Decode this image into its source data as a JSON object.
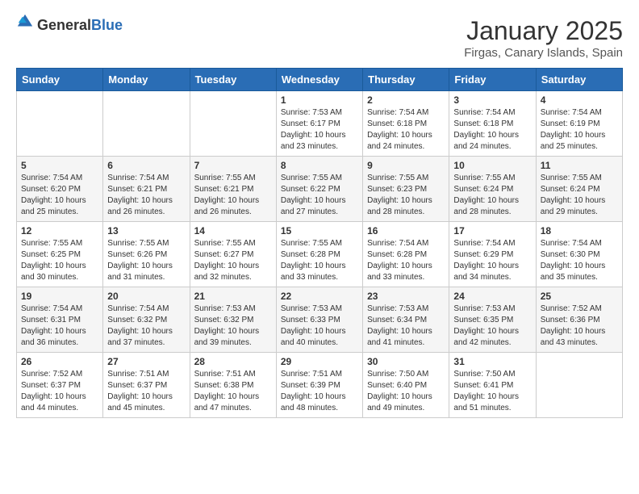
{
  "logo": {
    "general": "General",
    "blue": "Blue"
  },
  "title": "January 2025",
  "subtitle": "Firgas, Canary Islands, Spain",
  "weekdays": [
    "Sunday",
    "Monday",
    "Tuesday",
    "Wednesday",
    "Thursday",
    "Friday",
    "Saturday"
  ],
  "weeks": [
    [
      {
        "day": "",
        "info": ""
      },
      {
        "day": "",
        "info": ""
      },
      {
        "day": "",
        "info": ""
      },
      {
        "day": "1",
        "sunrise": "Sunrise: 7:53 AM",
        "sunset": "Sunset: 6:17 PM",
        "daylight": "Daylight: 10 hours and 23 minutes."
      },
      {
        "day": "2",
        "sunrise": "Sunrise: 7:54 AM",
        "sunset": "Sunset: 6:18 PM",
        "daylight": "Daylight: 10 hours and 24 minutes."
      },
      {
        "day": "3",
        "sunrise": "Sunrise: 7:54 AM",
        "sunset": "Sunset: 6:18 PM",
        "daylight": "Daylight: 10 hours and 24 minutes."
      },
      {
        "day": "4",
        "sunrise": "Sunrise: 7:54 AM",
        "sunset": "Sunset: 6:19 PM",
        "daylight": "Daylight: 10 hours and 25 minutes."
      }
    ],
    [
      {
        "day": "5",
        "sunrise": "Sunrise: 7:54 AM",
        "sunset": "Sunset: 6:20 PM",
        "daylight": "Daylight: 10 hours and 25 minutes."
      },
      {
        "day": "6",
        "sunrise": "Sunrise: 7:54 AM",
        "sunset": "Sunset: 6:21 PM",
        "daylight": "Daylight: 10 hours and 26 minutes."
      },
      {
        "day": "7",
        "sunrise": "Sunrise: 7:55 AM",
        "sunset": "Sunset: 6:21 PM",
        "daylight": "Daylight: 10 hours and 26 minutes."
      },
      {
        "day": "8",
        "sunrise": "Sunrise: 7:55 AM",
        "sunset": "Sunset: 6:22 PM",
        "daylight": "Daylight: 10 hours and 27 minutes."
      },
      {
        "day": "9",
        "sunrise": "Sunrise: 7:55 AM",
        "sunset": "Sunset: 6:23 PM",
        "daylight": "Daylight: 10 hours and 28 minutes."
      },
      {
        "day": "10",
        "sunrise": "Sunrise: 7:55 AM",
        "sunset": "Sunset: 6:24 PM",
        "daylight": "Daylight: 10 hours and 28 minutes."
      },
      {
        "day": "11",
        "sunrise": "Sunrise: 7:55 AM",
        "sunset": "Sunset: 6:24 PM",
        "daylight": "Daylight: 10 hours and 29 minutes."
      }
    ],
    [
      {
        "day": "12",
        "sunrise": "Sunrise: 7:55 AM",
        "sunset": "Sunset: 6:25 PM",
        "daylight": "Daylight: 10 hours and 30 minutes."
      },
      {
        "day": "13",
        "sunrise": "Sunrise: 7:55 AM",
        "sunset": "Sunset: 6:26 PM",
        "daylight": "Daylight: 10 hours and 31 minutes."
      },
      {
        "day": "14",
        "sunrise": "Sunrise: 7:55 AM",
        "sunset": "Sunset: 6:27 PM",
        "daylight": "Daylight: 10 hours and 32 minutes."
      },
      {
        "day": "15",
        "sunrise": "Sunrise: 7:55 AM",
        "sunset": "Sunset: 6:28 PM",
        "daylight": "Daylight: 10 hours and 33 minutes."
      },
      {
        "day": "16",
        "sunrise": "Sunrise: 7:54 AM",
        "sunset": "Sunset: 6:28 PM",
        "daylight": "Daylight: 10 hours and 33 minutes."
      },
      {
        "day": "17",
        "sunrise": "Sunrise: 7:54 AM",
        "sunset": "Sunset: 6:29 PM",
        "daylight": "Daylight: 10 hours and 34 minutes."
      },
      {
        "day": "18",
        "sunrise": "Sunrise: 7:54 AM",
        "sunset": "Sunset: 6:30 PM",
        "daylight": "Daylight: 10 hours and 35 minutes."
      }
    ],
    [
      {
        "day": "19",
        "sunrise": "Sunrise: 7:54 AM",
        "sunset": "Sunset: 6:31 PM",
        "daylight": "Daylight: 10 hours and 36 minutes."
      },
      {
        "day": "20",
        "sunrise": "Sunrise: 7:54 AM",
        "sunset": "Sunset: 6:32 PM",
        "daylight": "Daylight: 10 hours and 37 minutes."
      },
      {
        "day": "21",
        "sunrise": "Sunrise: 7:53 AM",
        "sunset": "Sunset: 6:32 PM",
        "daylight": "Daylight: 10 hours and 39 minutes."
      },
      {
        "day": "22",
        "sunrise": "Sunrise: 7:53 AM",
        "sunset": "Sunset: 6:33 PM",
        "daylight": "Daylight: 10 hours and 40 minutes."
      },
      {
        "day": "23",
        "sunrise": "Sunrise: 7:53 AM",
        "sunset": "Sunset: 6:34 PM",
        "daylight": "Daylight: 10 hours and 41 minutes."
      },
      {
        "day": "24",
        "sunrise": "Sunrise: 7:53 AM",
        "sunset": "Sunset: 6:35 PM",
        "daylight": "Daylight: 10 hours and 42 minutes."
      },
      {
        "day": "25",
        "sunrise": "Sunrise: 7:52 AM",
        "sunset": "Sunset: 6:36 PM",
        "daylight": "Daylight: 10 hours and 43 minutes."
      }
    ],
    [
      {
        "day": "26",
        "sunrise": "Sunrise: 7:52 AM",
        "sunset": "Sunset: 6:37 PM",
        "daylight": "Daylight: 10 hours and 44 minutes."
      },
      {
        "day": "27",
        "sunrise": "Sunrise: 7:51 AM",
        "sunset": "Sunset: 6:37 PM",
        "daylight": "Daylight: 10 hours and 45 minutes."
      },
      {
        "day": "28",
        "sunrise": "Sunrise: 7:51 AM",
        "sunset": "Sunset: 6:38 PM",
        "daylight": "Daylight: 10 hours and 47 minutes."
      },
      {
        "day": "29",
        "sunrise": "Sunrise: 7:51 AM",
        "sunset": "Sunset: 6:39 PM",
        "daylight": "Daylight: 10 hours and 48 minutes."
      },
      {
        "day": "30",
        "sunrise": "Sunrise: 7:50 AM",
        "sunset": "Sunset: 6:40 PM",
        "daylight": "Daylight: 10 hours and 49 minutes."
      },
      {
        "day": "31",
        "sunrise": "Sunrise: 7:50 AM",
        "sunset": "Sunset: 6:41 PM",
        "daylight": "Daylight: 10 hours and 51 minutes."
      },
      {
        "day": "",
        "info": ""
      }
    ]
  ]
}
